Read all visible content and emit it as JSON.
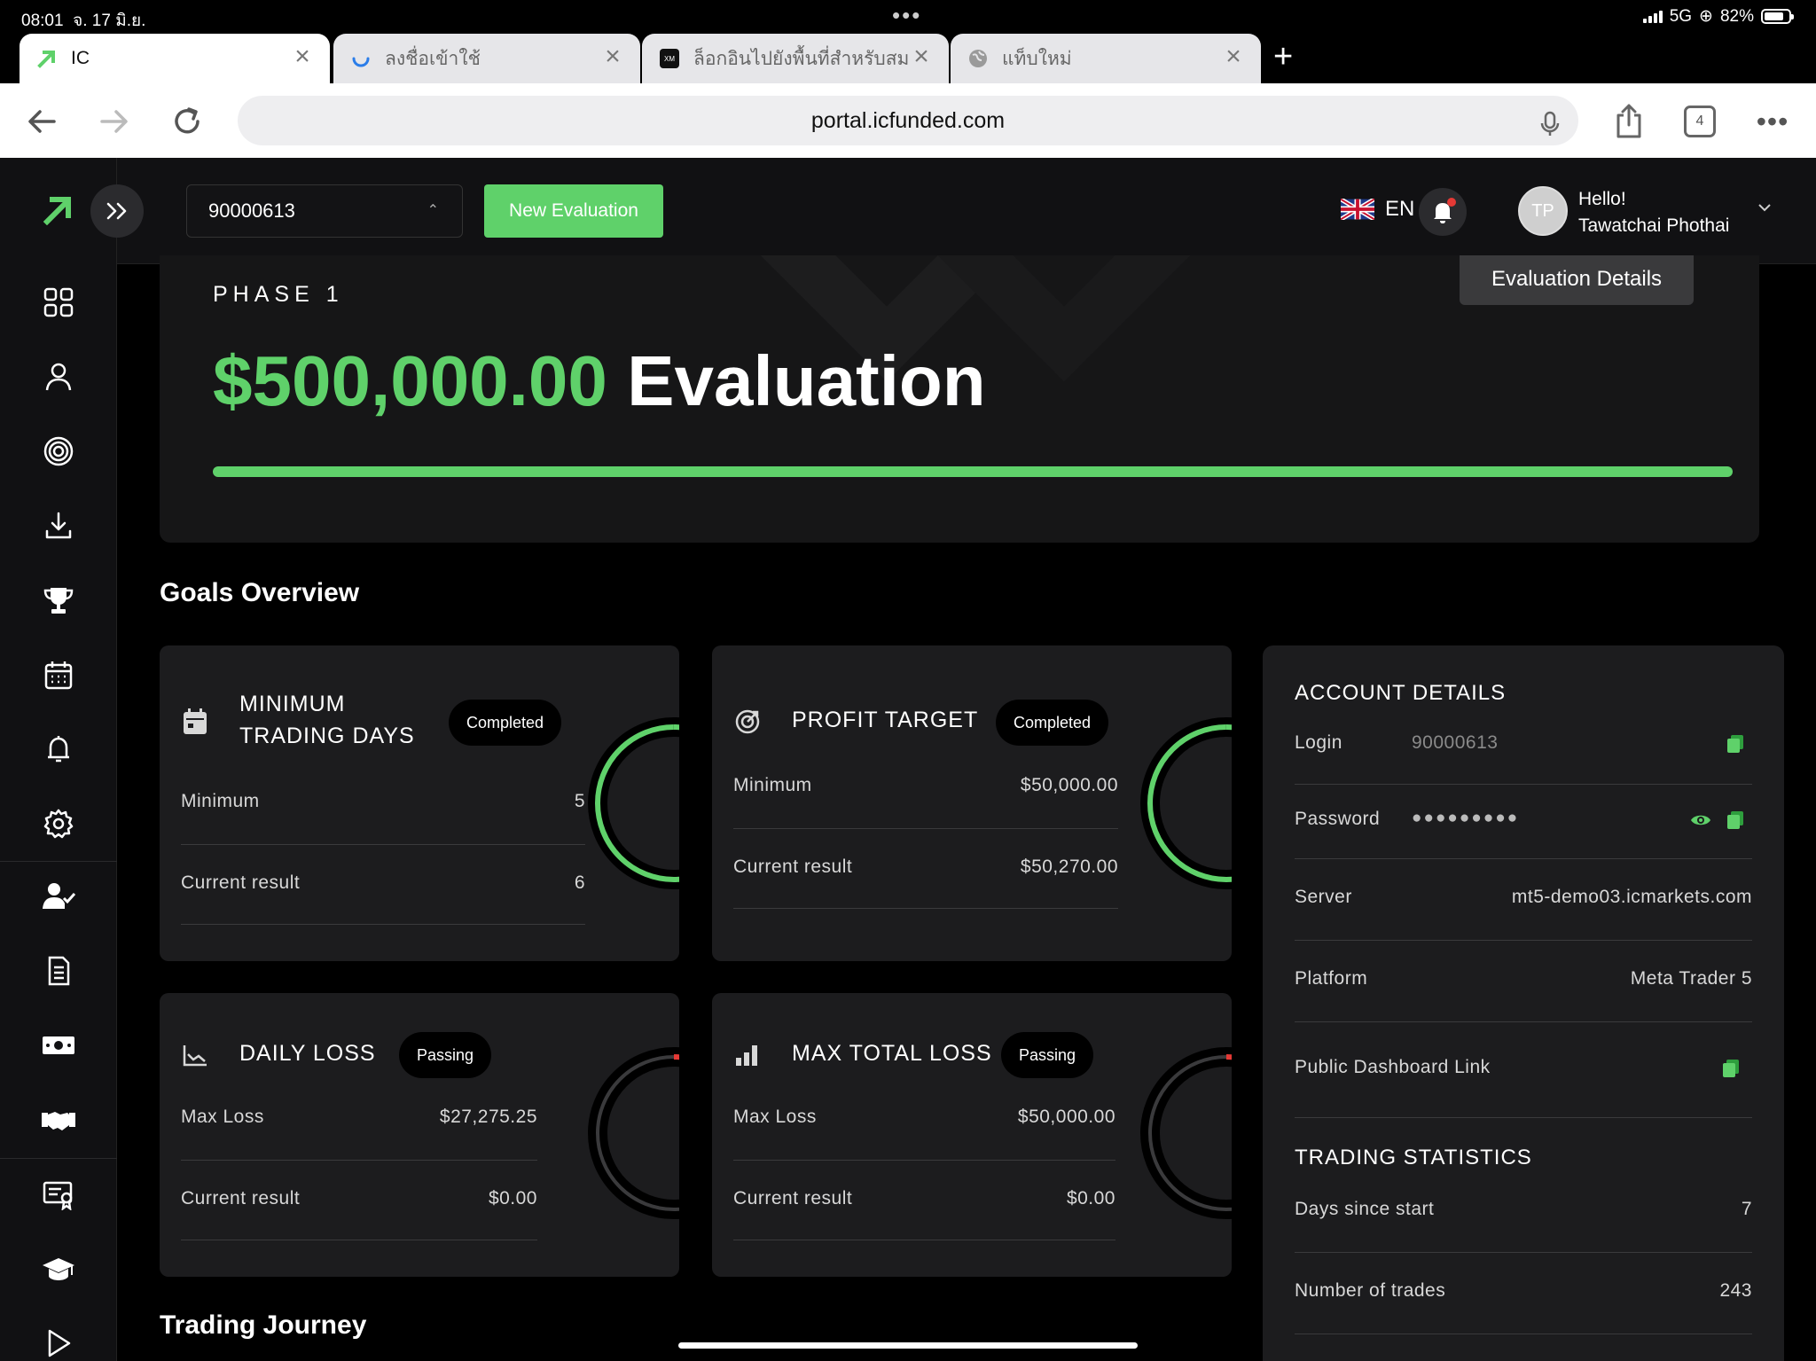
{
  "status_bar": {
    "time": "08:01",
    "date": "จ. 17 มิ.ย.",
    "network": "5G",
    "battery": "82%",
    "battery_level": 0.82
  },
  "tabs": [
    {
      "label": "IC",
      "active": true
    },
    {
      "label": "ลงชื่อเข้าใช้",
      "active": false
    },
    {
      "label": "ล็อกอินไปยังพื้นที่สำหรับสมา",
      "active": false
    },
    {
      "label": "แท็บใหม่",
      "active": false
    }
  ],
  "toolbar": {
    "url": "portal.icfunded.com",
    "tab_count": "4"
  },
  "header": {
    "account_number": "90000613",
    "new_evaluation_label": "New Evaluation",
    "language": "EN",
    "greeting": "Hello!",
    "user_name": "Tawatchai Phothai",
    "avatar_initials": "TP"
  },
  "hero": {
    "phase": "PHASE 1",
    "amount": "$500,000.00",
    "title_suffix": "Evaluation",
    "evaluation_details_label": "Evaluation Details",
    "progress": 1.0
  },
  "goals": {
    "section_title": "Goals Overview",
    "min_trading_days": {
      "title_line1": "MINIMUM",
      "title_line2": "TRADING DAYS",
      "status": "Completed",
      "minimum_label": "Minimum",
      "minimum_value": "5",
      "current_label": "Current result",
      "current_value": "6"
    },
    "profit_target": {
      "title": "PROFIT TARGET",
      "status": "Completed",
      "minimum_label": "Minimum",
      "minimum_value": "$50,000.00",
      "current_label": "Current result",
      "current_value": "$50,270.00"
    },
    "daily_loss": {
      "title": "DAILY LOSS",
      "status": "Passing",
      "max_label": "Max Loss",
      "max_value": "$27,275.25",
      "current_label": "Current result",
      "current_value": "$0.00"
    },
    "max_total_loss": {
      "title": "MAX TOTAL LOSS",
      "status": "Passing",
      "max_label": "Max Loss",
      "max_value": "$50,000.00",
      "current_label": "Current result",
      "current_value": "$0.00"
    }
  },
  "account_details": {
    "title": "ACCOUNT DETAILS",
    "login_label": "Login",
    "login_value": "90000613",
    "password_label": "Password",
    "password_value": "●●●●●●●●●",
    "server_label": "Server",
    "server_value": "mt5-demo03.icmarkets.com",
    "platform_label": "Platform",
    "platform_value": "Meta Trader 5",
    "public_link_label": "Public Dashboard Link"
  },
  "trading_statistics": {
    "title": "TRADING STATISTICS",
    "days_label": "Days since start",
    "days_value": "7",
    "trades_label": "Number of trades",
    "trades_value": "243"
  },
  "trading_journey": {
    "title": "Trading Journey"
  },
  "colors": {
    "accent": "#5fd16a",
    "danger": "#e53935",
    "card": "#1c1c1e",
    "background": "#000000"
  },
  "icons": {
    "sidebar": [
      "dashboard-icon",
      "user-icon",
      "target-icon",
      "download-icon",
      "trophy-icon",
      "calendar-icon",
      "bell-icon",
      "gear-icon",
      "user-check-icon",
      "document-icon",
      "money-icon",
      "handshake-icon",
      "certificate-icon",
      "graduation-cap-icon",
      "play-icon"
    ]
  }
}
